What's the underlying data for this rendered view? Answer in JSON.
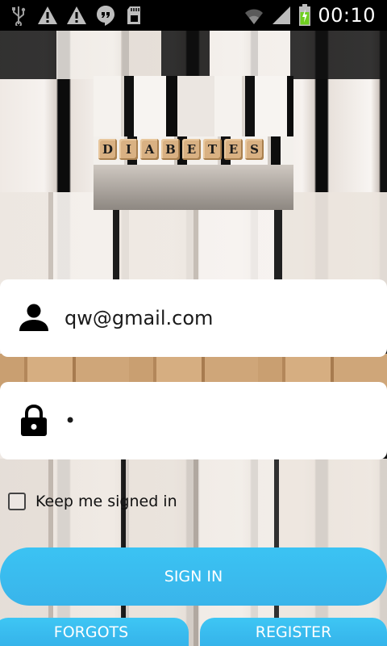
{
  "status_bar": {
    "time": "00:10",
    "left_icons": [
      "usb-icon",
      "warning-icon",
      "warning-icon",
      "hangouts-icon",
      "sd-card-icon"
    ],
    "right_icons": [
      "wifi-icon",
      "signal-icon",
      "battery-charging-icon"
    ]
  },
  "logo": {
    "letters": [
      "D",
      "I",
      "A",
      "B",
      "E",
      "T",
      "E",
      "S"
    ]
  },
  "form": {
    "email_value": "qw@gmail.com",
    "password_value": "•",
    "keep_signed_in_label": "Keep me signed in",
    "keep_signed_in_checked": false
  },
  "buttons": {
    "sign_in": "SIGN IN",
    "forgot": "FORGOTS",
    "register": "REGISTER"
  },
  "colors": {
    "accent": "#39b4ea",
    "status_bar": "#000000"
  }
}
